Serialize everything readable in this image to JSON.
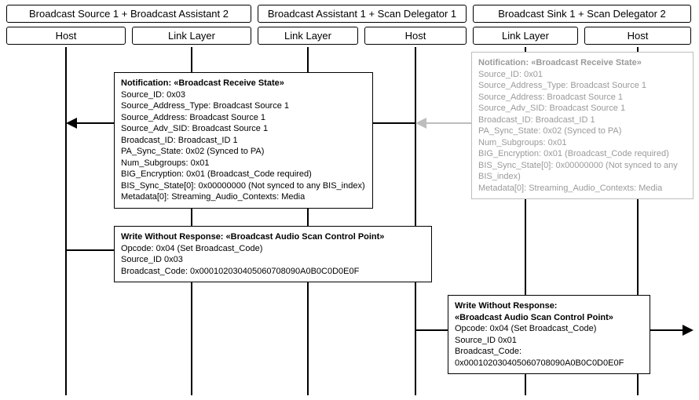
{
  "groups": [
    {
      "label": "Broadcast Source 1 + Broadcast Assistant 2"
    },
    {
      "label": "Broadcast Assistant 1 + Scan Delegator 1"
    },
    {
      "label": "Broadcast Sink 1 + Scan Delegator 2"
    }
  ],
  "lanes": {
    "g1_host": "Host",
    "g1_ll": "Link Layer",
    "g2_ll": "Link Layer",
    "g2_host": "Host",
    "g3_ll": "Link Layer",
    "g3_host": "Host"
  },
  "messages": {
    "notif_left": {
      "title": "Notification: «Broadcast Receive State»",
      "lines": [
        "Source_ID: 0x03",
        "Source_Address_Type: Broadcast Source 1",
        "Source_Address: Broadcast Source 1",
        "Source_Adv_SID: Broadcast Source 1",
        "Broadcast_ID: Broadcast_ID 1",
        "PA_Sync_State: 0x02 (Synced to PA)",
        "Num_Subgroups: 0x01",
        "BIG_Encryption: 0x01 (Broadcast_Code required)",
        "BIS_Sync_State[0]: 0x00000000 (Not synced to any BIS_index)",
        "Metadata[0]: Streaming_Audio_Contexts: Media"
      ]
    },
    "notif_right_ghost": {
      "title": "Notification: «Broadcast Receive State»",
      "lines": [
        "Source_ID: 0x01",
        "Source_Address_Type: Broadcast Source 1",
        "Source_Address: Broadcast Source 1",
        "Source_Adv_SID: Broadcast Source 1",
        "Broadcast_ID: Broadcast_ID 1",
        "PA_Sync_State: 0x02 (Synced to PA)",
        "Num_Subgroups: 0x01",
        "BIG_Encryption: 0x01 (Broadcast_Code required)",
        "BIS_Sync_State[0]: 0x00000000 (Not synced to any BIS_index)",
        "Metadata[0]: Streaming_Audio_Contexts: Media"
      ]
    },
    "write_left": {
      "title": "Write Without Response: «Broadcast Audio Scan Control Point»",
      "lines": [
        "Opcode: 0x04 (Set Broadcast_Code)",
        "Source_ID 0x03",
        "Broadcast_Code: 0x000102030405060708090A0B0C0D0E0F"
      ]
    },
    "write_right": {
      "title_line1": "Write Without Response:",
      "title_line2": "«Broadcast Audio Scan Control Point»",
      "lines": [
        "Opcode: 0x04 (Set Broadcast_Code)",
        "Source_ID 0x01",
        "Broadcast_Code:",
        "0x000102030405060708090A0B0C0D0E0F"
      ]
    }
  }
}
